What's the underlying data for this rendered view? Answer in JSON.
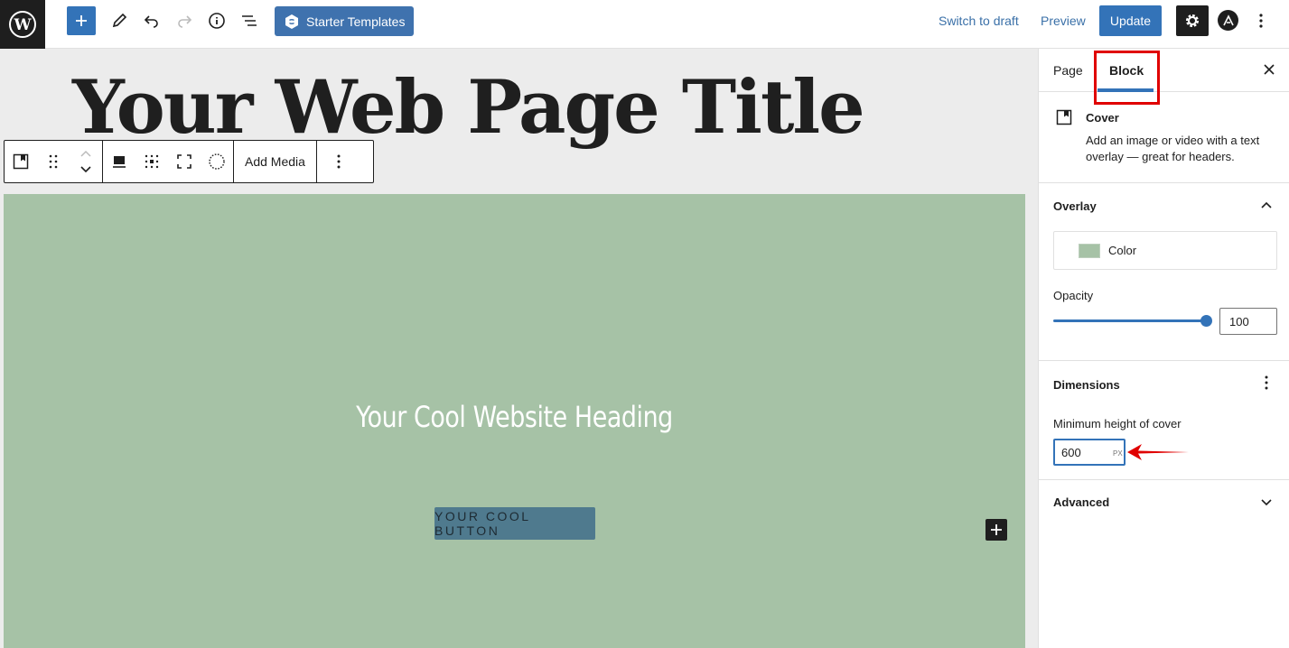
{
  "toolbar": {
    "starter_templates_label": "Starter Templates",
    "switch_to_draft_label": "Switch to draft",
    "preview_label": "Preview",
    "update_label": "Update"
  },
  "editor": {
    "page_title": "Your Web Page Title",
    "block_toolbar": {
      "add_media_label": "Add Media"
    },
    "cover": {
      "heading": "Your Cool Website Heading",
      "button_label": "YOUR COOL BUTTON",
      "overlay_color": "#a6c2a6"
    }
  },
  "sidebar": {
    "tabs": [
      {
        "label": "Page",
        "active": false
      },
      {
        "label": "Block",
        "active": true
      }
    ],
    "block_card": {
      "name": "Cover",
      "description": "Add an image or video with a text overlay — great for headers."
    },
    "overlay": {
      "title": "Overlay",
      "color_label": "Color",
      "opacity_label": "Opacity",
      "opacity_value": "100",
      "opacity_fraction": 1.0
    },
    "dimensions": {
      "title": "Dimensions",
      "min_height_label": "Minimum height of cover",
      "min_height_value": "600",
      "unit": "PX"
    },
    "advanced": {
      "title": "Advanced"
    }
  },
  "colors": {
    "accent": "#3373b8",
    "highlight": "#e00000",
    "cover_bg": "#a6c2a6",
    "cover_button": "#4f7a8e"
  }
}
